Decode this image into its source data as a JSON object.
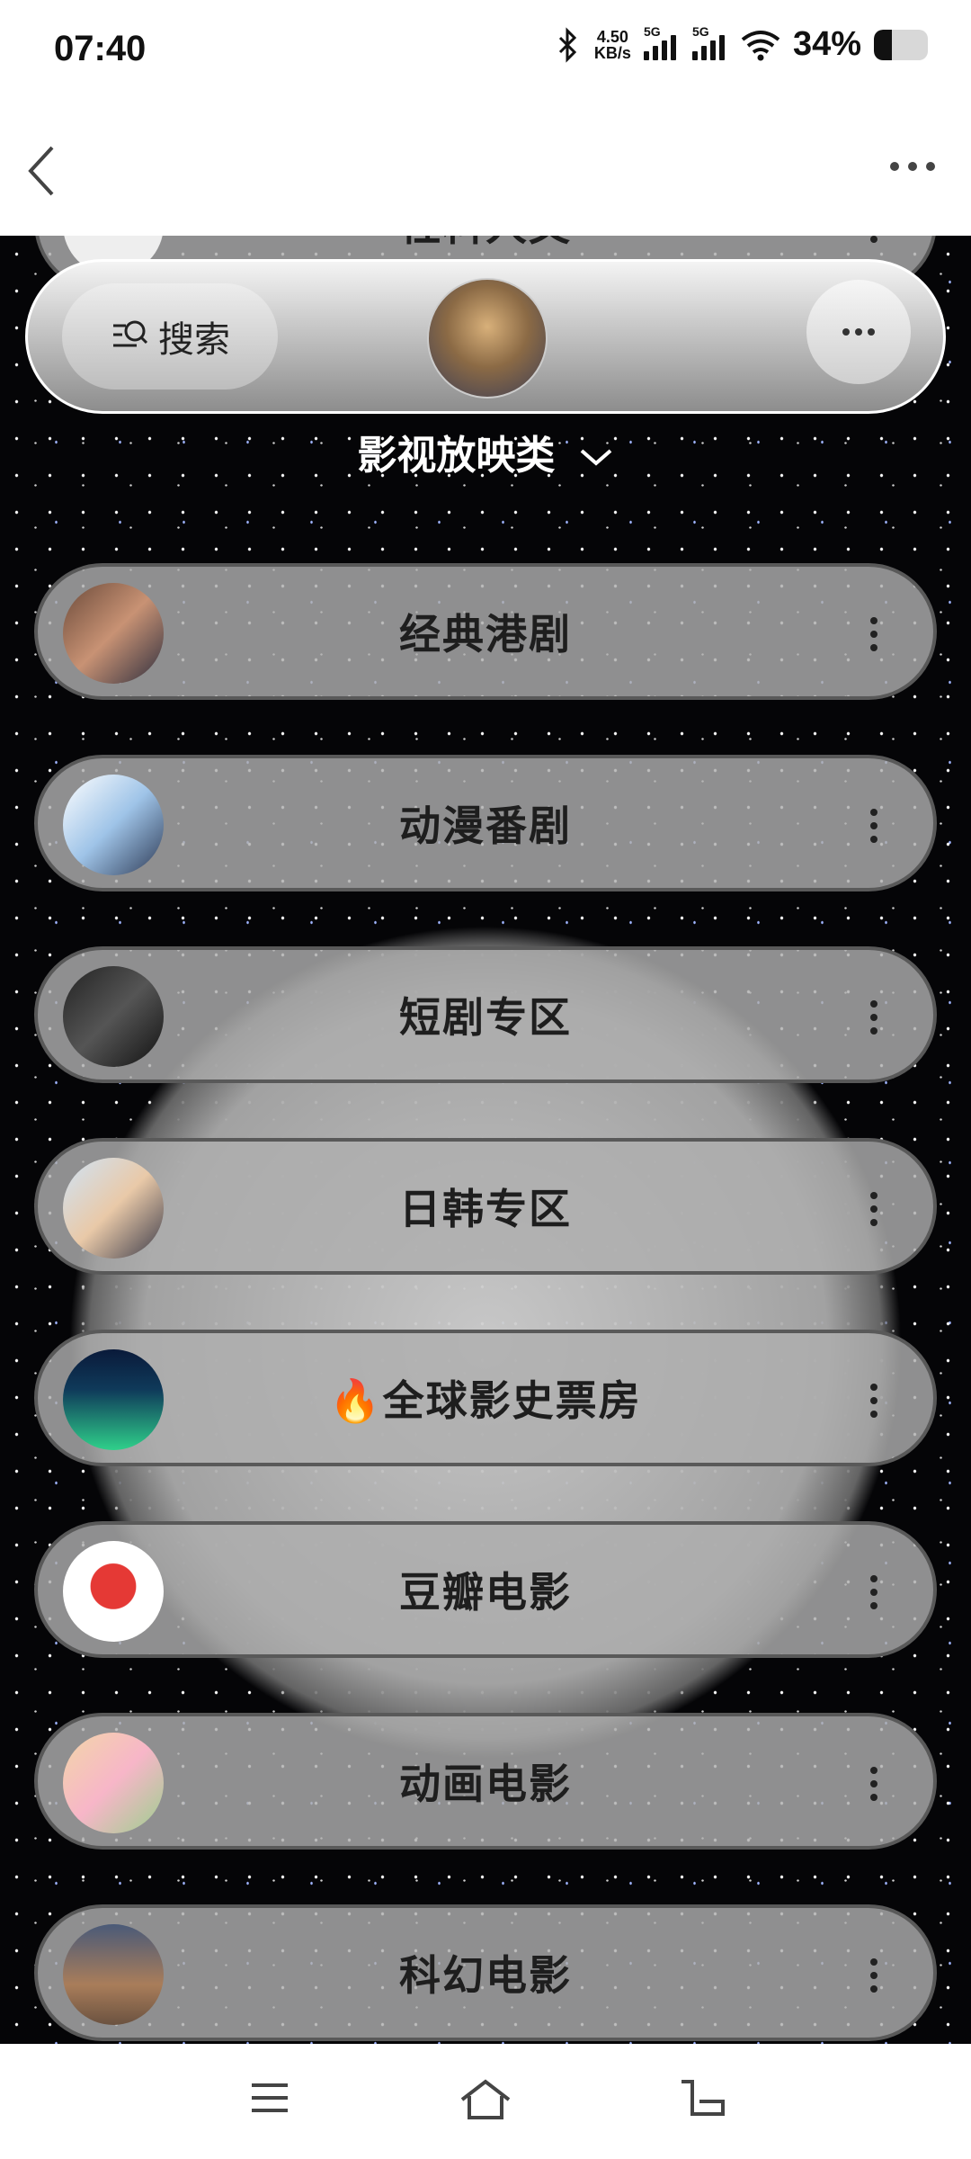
{
  "status": {
    "time": "07:40",
    "net_speed_value": "4.50",
    "net_speed_unit": "KB/s",
    "signal1": "5G",
    "signal2": "5G",
    "battery_percent": "34%",
    "battery_level": 0.34
  },
  "header": {
    "search_label": "搜索",
    "section_title": "影视放映类"
  },
  "rows": [
    {
      "label": "经典港剧"
    },
    {
      "label": "动漫番剧"
    },
    {
      "label": "短剧专区"
    },
    {
      "label": "日韩专区"
    },
    {
      "label": "🔥全球影史票房"
    },
    {
      "label": "豆瓣电影"
    },
    {
      "label": "动画电影"
    },
    {
      "label": "科幻电影"
    }
  ],
  "partial_row": {
    "label": "社科人文"
  }
}
